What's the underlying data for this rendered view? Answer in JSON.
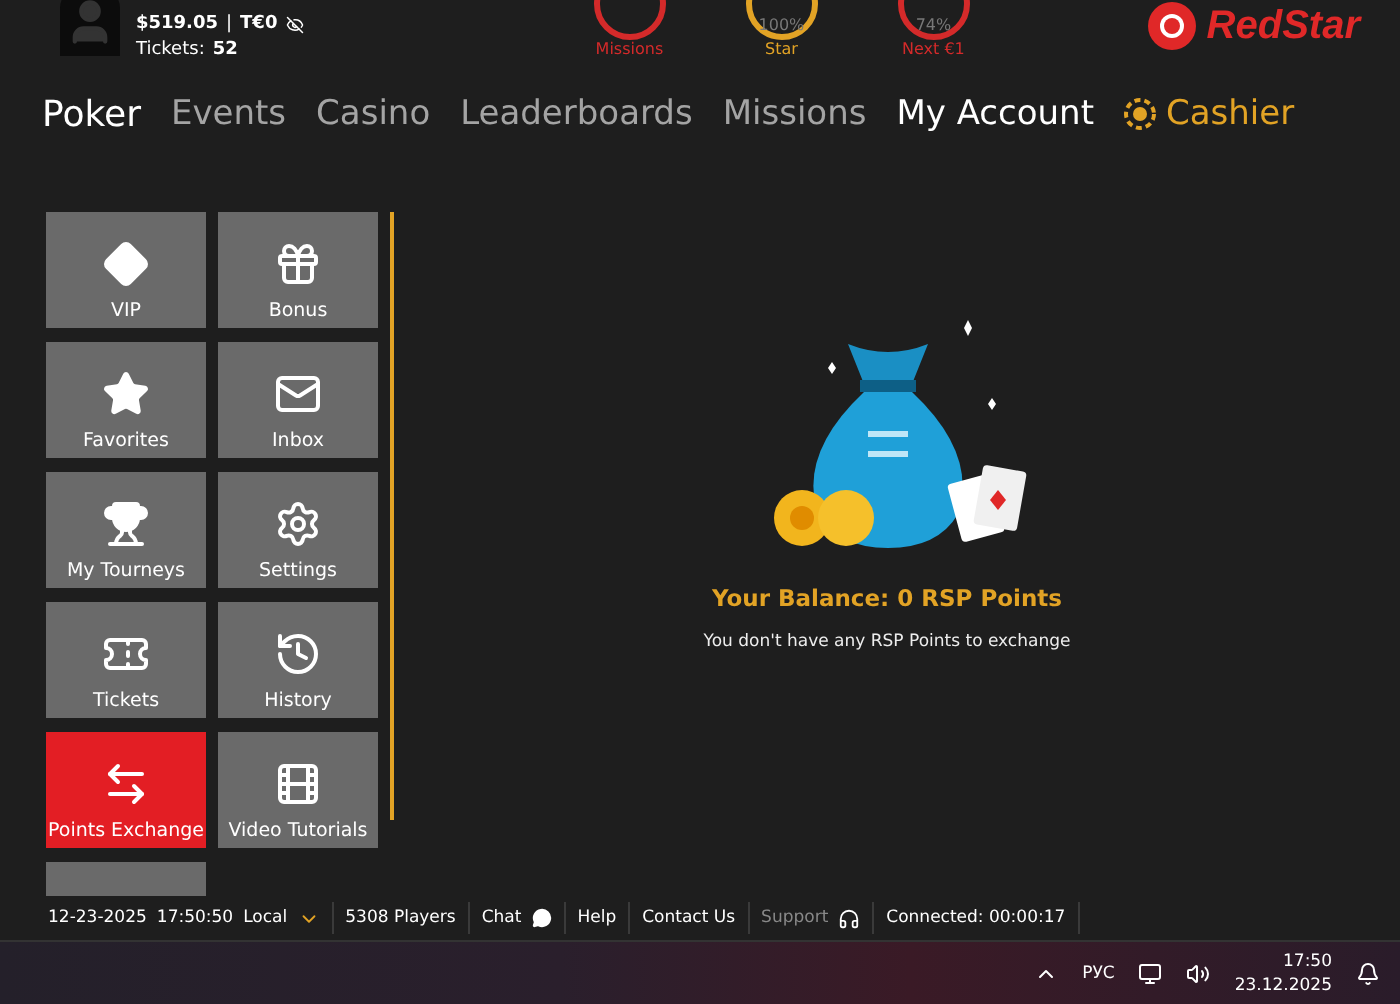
{
  "header": {
    "balance": "$519.05",
    "separator": "|",
    "tournament_money": "T€0",
    "tickets_label": "Tickets:",
    "tickets_count": "52",
    "progress": [
      {
        "kind": "missions",
        "label": "Missions"
      },
      {
        "kind": "star",
        "label": "Star",
        "percent": "100%"
      },
      {
        "kind": "next",
        "label": "Next €1",
        "percent": "74%"
      }
    ],
    "logo": "RedStar"
  },
  "nav": {
    "product": "Poker",
    "items": [
      {
        "label": "Events",
        "selected": false,
        "kind": "link"
      },
      {
        "label": "Casino",
        "selected": false,
        "kind": "link"
      },
      {
        "label": "Leaderboards",
        "selected": false,
        "kind": "link"
      },
      {
        "label": "Missions",
        "selected": false,
        "kind": "link"
      },
      {
        "label": "My Account",
        "selected": true,
        "kind": "link"
      },
      {
        "label": "Cashier",
        "selected": false,
        "kind": "cashier"
      }
    ]
  },
  "tiles": [
    {
      "label": "VIP",
      "selected": false
    },
    {
      "label": "Bonus",
      "selected": false
    },
    {
      "label": "Favorites",
      "selected": false
    },
    {
      "label": "Inbox",
      "selected": false
    },
    {
      "label": "My Tourneys",
      "selected": false
    },
    {
      "label": "Settings",
      "selected": false
    },
    {
      "label": "Tickets",
      "selected": false
    },
    {
      "label": "History",
      "selected": false
    },
    {
      "label": "Points Exchange",
      "selected": true
    },
    {
      "label": "Video Tutorials",
      "selected": false
    }
  ],
  "balance": {
    "title": "Your Balance: 0 RSP Points",
    "message": "You don't have any RSP Points to exchange"
  },
  "status_bar": {
    "date": "12-23-2025",
    "time": "17:50:50",
    "timezone": "Local",
    "players": "5308 Players",
    "chat": "Chat",
    "help": "Help",
    "contact": "Contact Us",
    "support": "Support",
    "connected": "Connected: 00:00:17"
  },
  "taskbar": {
    "language": "РУС",
    "time": "17:50",
    "date": "23.12.2025"
  }
}
